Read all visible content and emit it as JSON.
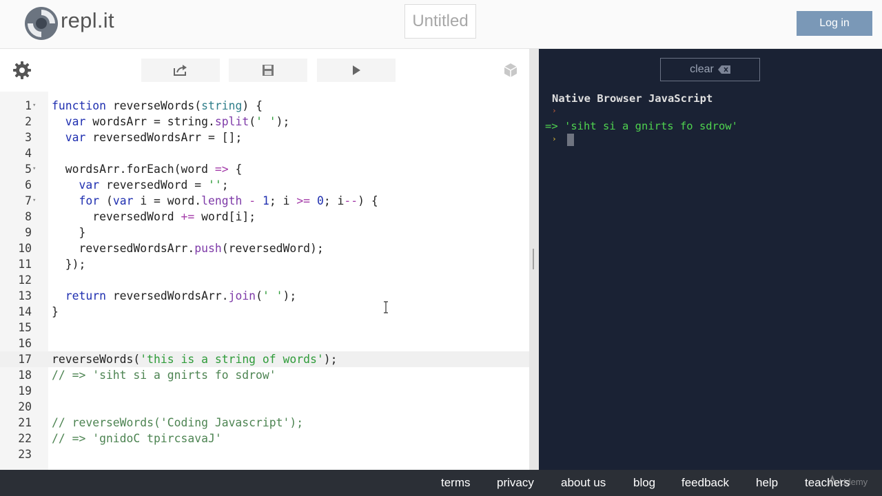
{
  "header": {
    "logo_text": "repl.it",
    "title": "Untitled",
    "login_label": "Log in"
  },
  "editor": {
    "toolbar": {
      "settings_icon": "gear-icon",
      "share_icon": "share-icon",
      "save_icon": "save-icon",
      "run_icon": "play-icon",
      "packages_icon": "cube-icon"
    },
    "active_line": 17,
    "lines": [
      {
        "n": "1",
        "fold": true
      },
      {
        "n": "2"
      },
      {
        "n": "3"
      },
      {
        "n": "4"
      },
      {
        "n": "5",
        "fold": true
      },
      {
        "n": "6"
      },
      {
        "n": "7",
        "fold": true
      },
      {
        "n": "8"
      },
      {
        "n": "9"
      },
      {
        "n": "10"
      },
      {
        "n": "11"
      },
      {
        "n": "12"
      },
      {
        "n": "13"
      },
      {
        "n": "14"
      },
      {
        "n": "15"
      },
      {
        "n": "16"
      },
      {
        "n": "17"
      },
      {
        "n": "18"
      },
      {
        "n": "19"
      },
      {
        "n": "20"
      },
      {
        "n": "21"
      },
      {
        "n": "22"
      },
      {
        "n": "23"
      }
    ],
    "code": [
      [
        [
          "kw",
          "function "
        ],
        [
          "fn",
          "reverseWords"
        ],
        [
          "",
          "("
        ],
        [
          "prm",
          "string"
        ],
        [
          "",
          ") {"
        ]
      ],
      [
        [
          "",
          ""
        ],
        [
          "kw",
          "  var "
        ],
        [
          "",
          "wordsArr = string."
        ],
        [
          "prop",
          "split"
        ],
        [
          "",
          "("
        ],
        [
          "str",
          "' '"
        ],
        [
          "",
          ");"
        ]
      ],
      [
        [
          "kw",
          "  var "
        ],
        [
          "",
          "reversedWordsArr = [];"
        ]
      ],
      [],
      [
        [
          "",
          "  wordsArr.forEach(word "
        ],
        [
          "op",
          "=>"
        ],
        [
          "",
          " {"
        ]
      ],
      [
        [
          "kw",
          "    var "
        ],
        [
          "",
          "reversedWord = "
        ],
        [
          "str",
          "''"
        ],
        [
          "",
          ";"
        ]
      ],
      [
        [
          "kw",
          "    for "
        ],
        [
          "",
          "("
        ],
        [
          "kw",
          "var "
        ],
        [
          "",
          "i = word."
        ],
        [
          "prop",
          "length"
        ],
        [
          "op",
          " - "
        ],
        [
          "num",
          "1"
        ],
        [
          "",
          "; i "
        ],
        [
          "op",
          ">="
        ],
        [
          "",
          " "
        ],
        [
          "num",
          "0"
        ],
        [
          "",
          "; i"
        ],
        [
          "op",
          "--"
        ],
        [
          "",
          ") {"
        ]
      ],
      [
        [
          "",
          "      reversedWord "
        ],
        [
          "op",
          "+="
        ],
        [
          "",
          " word[i];"
        ]
      ],
      [
        [
          "",
          "    }"
        ]
      ],
      [
        [
          "",
          "    reversedWordsArr."
        ],
        [
          "prop",
          "push"
        ],
        [
          "",
          "(reversedWord);"
        ]
      ],
      [
        [
          "",
          "  });"
        ]
      ],
      [],
      [
        [
          "kw",
          "  return "
        ],
        [
          "",
          "reversedWordsArr."
        ],
        [
          "prop",
          "join"
        ],
        [
          "",
          "("
        ],
        [
          "str",
          "' '"
        ],
        [
          "",
          ");"
        ]
      ],
      [
        [
          "",
          "}"
        ]
      ],
      [],
      [],
      [
        [
          "",
          "reverseWords("
        ],
        [
          "str",
          "'this is a string of words'"
        ],
        [
          "",
          ");"
        ]
      ],
      [
        [
          "cmt",
          "// => 'siht si a gnirts fo sdrow'"
        ]
      ],
      [],
      [],
      [
        [
          "cmt",
          "// reverseWords('Coding Javascript');"
        ]
      ],
      [
        [
          "cmt",
          "// => 'gnidoC tpircsavaJ'"
        ]
      ],
      []
    ]
  },
  "console": {
    "clear_label": "clear",
    "header": "Native Browser JavaScript",
    "prompt_symbol": "›",
    "result": "=> 'siht si a gnirts fo sdrow'"
  },
  "footer": {
    "terms": "terms",
    "privacy": "privacy",
    "about": "about us",
    "blog": "blog",
    "feedback": "feedback",
    "help": "help",
    "teachers": "teachers",
    "watermark": "Udemy"
  },
  "colors": {
    "console_bg": "#1a2234",
    "login_bg": "#7a98b7",
    "footer_bg": "#2b2f36",
    "result_green": "#4fd34f"
  }
}
